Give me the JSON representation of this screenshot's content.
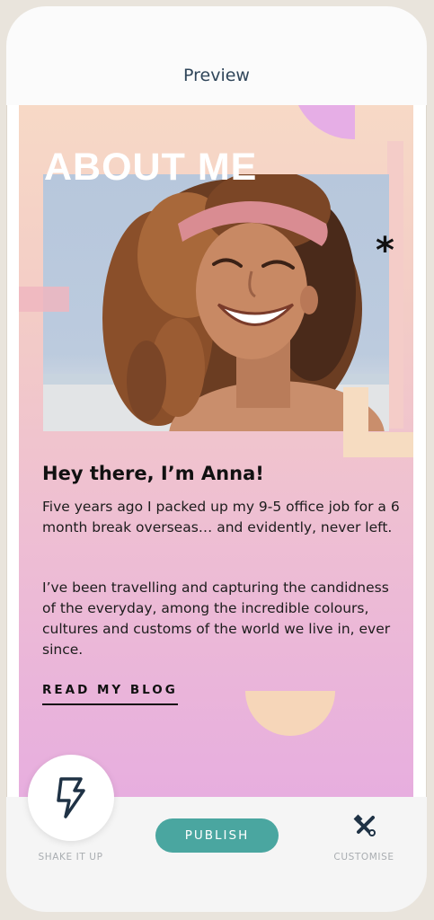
{
  "header": {
    "title": "Preview"
  },
  "card": {
    "heading": "ABOUT ME",
    "greeting": "Hey there, I’m Anna!",
    "paragraphs": [
      "Five years ago I packed up my 9-5 office job for a 6 month break overseas… and evidently, never left.",
      "I’ve been travelling and capturing the candidness of the everyday, among the incredible colours, cultures and customs of the world we live in, ever since."
    ],
    "link_label": "READ MY BLOG",
    "asterisk": "*"
  },
  "bottom_bar": {
    "shake_label": "SHAKE IT UP",
    "publish_label": "PUBLISH",
    "customise_label": "CUSTOMISE",
    "shake_icon": "lightning-bolt-icon",
    "customise_icon": "tools-icon"
  },
  "colors": {
    "accent": "#4aa6a0",
    "header_text": "#30465a",
    "icon_navy": "#1f3245"
  }
}
